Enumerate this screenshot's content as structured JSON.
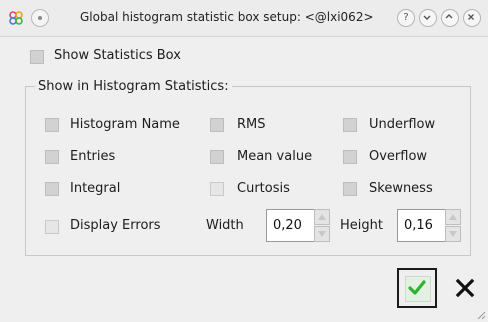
{
  "window": {
    "title": "Global histogram statistic box setup: <@lxi062>"
  },
  "show_stats_label": "Show Statistics Box",
  "group": {
    "title": "Show in Histogram Statistics:",
    "options": {
      "histogram_name": {
        "label": "Histogram Name",
        "checked": false
      },
      "rms": {
        "label": "RMS",
        "checked": false
      },
      "underflow": {
        "label": "Underflow",
        "checked": false
      },
      "entries": {
        "label": "Entries",
        "checked": false
      },
      "mean_value": {
        "label": "Mean value",
        "checked": false
      },
      "overflow": {
        "label": "Overflow",
        "checked": false
      },
      "integral": {
        "label": "Integral",
        "checked": false
      },
      "curtosis": {
        "label": "Curtosis",
        "checked": false
      },
      "skewness": {
        "label": "Skewness",
        "checked": false
      },
      "display_errors": {
        "label": "Display Errors",
        "checked": false
      }
    },
    "width_label": "Width",
    "width_value": "0,20",
    "height_label": "Height",
    "height_value": "0,16"
  },
  "colors": {
    "ok_check": "#2db32d"
  },
  "icons": {
    "app": "colored-circles-icon",
    "help": "question-mark-icon",
    "minimize": "chevron-down-icon",
    "maximize": "chevron-up-icon",
    "close": "close-icon",
    "ok": "checkmark-icon",
    "cancel": "x-icon"
  }
}
